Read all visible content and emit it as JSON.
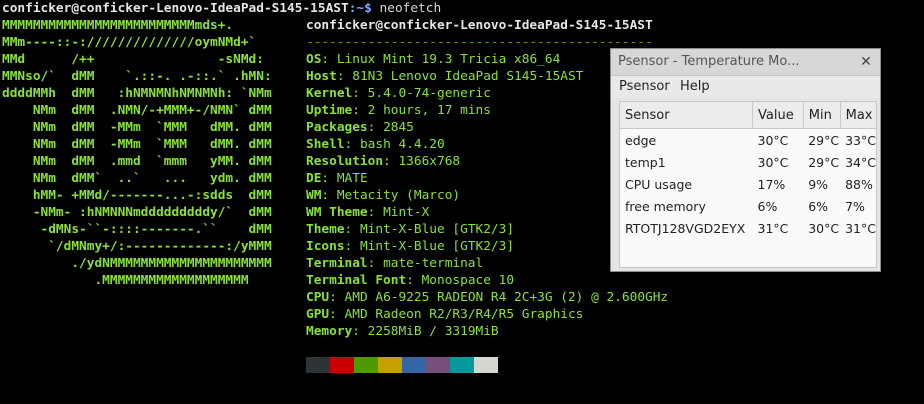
{
  "terminal": {
    "prompt_user": "conficker@conficker-Lenovo-IdeaPad-S145-15AST",
    "prompt_path": ":~$",
    "prompt_cmd": " neofetch",
    "logo_lines": [
      "MMMMMMMMMMMMMMMMMMMMMMMMMmds+.",
      "MMm----::-://////////////oymNMd+`",
      "MMd      /++                -sNMd:",
      "MMNso/`  dMM    `.::-. .-::.` .hMN:",
      "ddddMMh  dMM   :hNMNMNhNMNMNh: `NMm",
      "    NMm  dMM  .NMN/-+MMM+-/NMN` dMM",
      "    NMm  dMM  -MMm  `MMM   dMM. dMM",
      "    NMm  dMM  -MMm  `MMM   dMM. dMM",
      "    NMm  dMM  .mmd  `mmm   yMM. dMM",
      "    NMm  dMM`  ..`   ...   ydm. dMM",
      "    hMM- +MMd/-------...-:sdds  dMM",
      "    -NMm- :hNMNNNmdddddddddy/`  dMM",
      "     -dMNs-``-::::-------.``    dMM",
      "      `/dMNmy+/:-------------:/yMMM",
      "         ./ydNMMMMMMMMMMMMMMMMMMMMM",
      "            .MMMMMMMMMMMMMMMMMMM"
    ],
    "header": "conficker@conficker-Lenovo-IdeaPad-S145-15AST",
    "separator": "---------------------------------------------",
    "info": [
      {
        "key": "OS",
        "value": "Linux Mint 19.3 Tricia x86_64"
      },
      {
        "key": "Host",
        "value": "81N3 Lenovo IdeaPad S145-15AST"
      },
      {
        "key": "Kernel",
        "value": "5.4.0-74-generic"
      },
      {
        "key": "Uptime",
        "value": "2 hours, 17 mins"
      },
      {
        "key": "Packages",
        "value": "2845"
      },
      {
        "key": "Shell",
        "value": "bash 4.4.20"
      },
      {
        "key": "Resolution",
        "value": "1366x768"
      },
      {
        "key": "DE",
        "value": "MATE"
      },
      {
        "key": "WM",
        "value": "Metacity (Marco)"
      },
      {
        "key": "WM Theme",
        "value": "Mint-X"
      },
      {
        "key": "Theme",
        "value": "Mint-X-Blue [GTK2/3]"
      },
      {
        "key": "Icons",
        "value": "Mint-X-Blue [GTK2/3]"
      },
      {
        "key": "Terminal",
        "value": "mate-terminal"
      },
      {
        "key": "Terminal Font",
        "value": "Monospace 10"
      },
      {
        "key": "CPU",
        "value": "AMD A6-9225 RADEON R4 2C+3G (2) @ 2.600GHz"
      },
      {
        "key": "GPU",
        "value": "AMD Radeon R2/R3/R4/R5 Graphics"
      },
      {
        "key": "Memory",
        "value": "2258MiB / 3319MiB"
      }
    ],
    "swatch_colors": [
      "#2e3436",
      "#cc0000",
      "#4e9a06",
      "#c4a000",
      "#3465a4",
      "#75507b",
      "#06989a",
      "#d3d7cf"
    ]
  },
  "psensor": {
    "title": "Psensor - Temperature Mo...",
    "menu": [
      "Psensor",
      "Help"
    ],
    "columns": [
      "Sensor",
      "Value",
      "Min",
      "Max"
    ],
    "rows": [
      [
        "edge",
        "30°C",
        "29°C",
        "33°C"
      ],
      [
        "temp1",
        "30°C",
        "29°C",
        "34°C"
      ],
      [
        "CPU usage",
        "17%",
        "9%",
        "88%"
      ],
      [
        "free memory",
        "6%",
        "6%",
        "7%"
      ],
      [
        "RTOTJ128VGD2EYX",
        "31°C",
        "30°C",
        "31°C"
      ]
    ]
  }
}
